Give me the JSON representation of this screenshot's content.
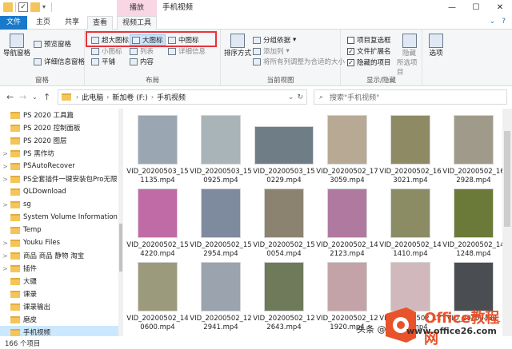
{
  "titlebar": {
    "context_tab": "播放",
    "title": "手机视频",
    "controls": [
      "—",
      "☐",
      "✕"
    ]
  },
  "tabs": {
    "file": "文件",
    "home": "主页",
    "share": "共享",
    "view": "查看",
    "video_tools": "视频工具"
  },
  "ribbon": {
    "panes": {
      "nav_pane": "导航窗格",
      "preview_pane": "预览窗格",
      "details_pane": "详细信息窗格",
      "label": "窗格"
    },
    "layout": {
      "extra_large": "超大图标",
      "large": "大图标",
      "medium": "中图标",
      "small": "小图标",
      "list": "列表",
      "details": "详细信息",
      "tiles": "平铺",
      "content": "内容",
      "label": "布局"
    },
    "current_view": {
      "sort_by": "排序方式",
      "group_by": "分组依据",
      "add_columns": "添加列",
      "fit_columns": "将所有列调整为合适的大小",
      "label": "当前视图"
    },
    "show_hide": {
      "item_checkboxes": "项目复选框",
      "file_extensions": "文件扩展名",
      "hidden_items": "隐藏的项目",
      "hide_selected": "隐藏",
      "hide_selected_sub": "所选项目",
      "label": "显示/隐藏",
      "item_checkboxes_checked": false,
      "file_extensions_checked": true,
      "hidden_items_checked": true
    },
    "options": "选项"
  },
  "address": {
    "crumbs": [
      "此电脑",
      "新加卷 (F:)",
      "手机视频"
    ],
    "search_placeholder": "搜索\"手机视频\""
  },
  "sidebar": {
    "items": [
      {
        "label": "PS 2020 工具篇",
        "chevron": ""
      },
      {
        "label": "PS 2020 控制面板",
        "chevron": ""
      },
      {
        "label": "PS 2020 图层",
        "chevron": ""
      },
      {
        "label": "PS 黑作坊",
        "chevron": ">"
      },
      {
        "label": "PSAutoRecover",
        "chevron": ">"
      },
      {
        "label": "PS全套插件一键安装包Pro无限",
        "chevron": ">"
      },
      {
        "label": "QLDownload",
        "chevron": ""
      },
      {
        "label": "sg",
        "chevron": ">"
      },
      {
        "label": "System Volume Information",
        "chevron": ""
      },
      {
        "label": "Temp",
        "chevron": ""
      },
      {
        "label": "Youku Files",
        "chevron": ">"
      },
      {
        "label": "商品 商品 静物 淘宝",
        "chevron": ">"
      },
      {
        "label": "插件",
        "chevron": ">"
      },
      {
        "label": "大疆",
        "chevron": ""
      },
      {
        "label": "课录",
        "chevron": ""
      },
      {
        "label": "课录输出",
        "chevron": ""
      },
      {
        "label": "磨皮",
        "chevron": ""
      },
      {
        "label": "手机视频",
        "chevron": ""
      }
    ]
  },
  "files": [
    {
      "name": "VID_20200503_151135.mp4",
      "color": "#9aa7b2"
    },
    {
      "name": "VID_20200503_150925.mp4",
      "color": "#a9b4b8"
    },
    {
      "name": "VID_20200503_150229.mp4",
      "color": "#6f7d86"
    },
    {
      "name": "VID_20200502_173059.mp4",
      "color": "#b7a994"
    },
    {
      "name": "VID_20200502_163021.mp4",
      "color": "#8e8a63"
    },
    {
      "name": "VID_20200502_162928.mp4",
      "color": "#a09a8a"
    },
    {
      "name": "VID_20200502_154220.mp4",
      "color": "#c06ba5"
    },
    {
      "name": "VID_20200502_152954.mp4",
      "color": "#7e8a9e"
    },
    {
      "name": "VID_20200502_150054.mp4",
      "color": "#8c8270"
    },
    {
      "name": "VID_20200502_142123.mp4",
      "color": "#b07aa0"
    },
    {
      "name": "VID_20200502_141410.mp4",
      "color": "#8b8c64"
    },
    {
      "name": "VID_20200502_141248.mp4",
      "color": "#6b7a38"
    },
    {
      "name": "VID_20200502_140600.mp4",
      "color": "#9b9a7c"
    },
    {
      "name": "VID_20200502_122941.mp4",
      "color": "#9aa3ae"
    },
    {
      "name": "VID_20200502_122643.mp4",
      "color": "#6f7a5a"
    },
    {
      "name": "VID_20200502_121920.mp4",
      "color": "#c4a3a8"
    },
    {
      "name": "VID_20200502_121706.mp4",
      "color": "#d1b8bc"
    },
    {
      "name": "VID_20200430_",
      "color": "#4a4d52"
    }
  ],
  "status": "166 个项目",
  "watermark": {
    "prefix": "头条 @",
    "brand": "Office教程网",
    "sub": "www.office26.com"
  }
}
